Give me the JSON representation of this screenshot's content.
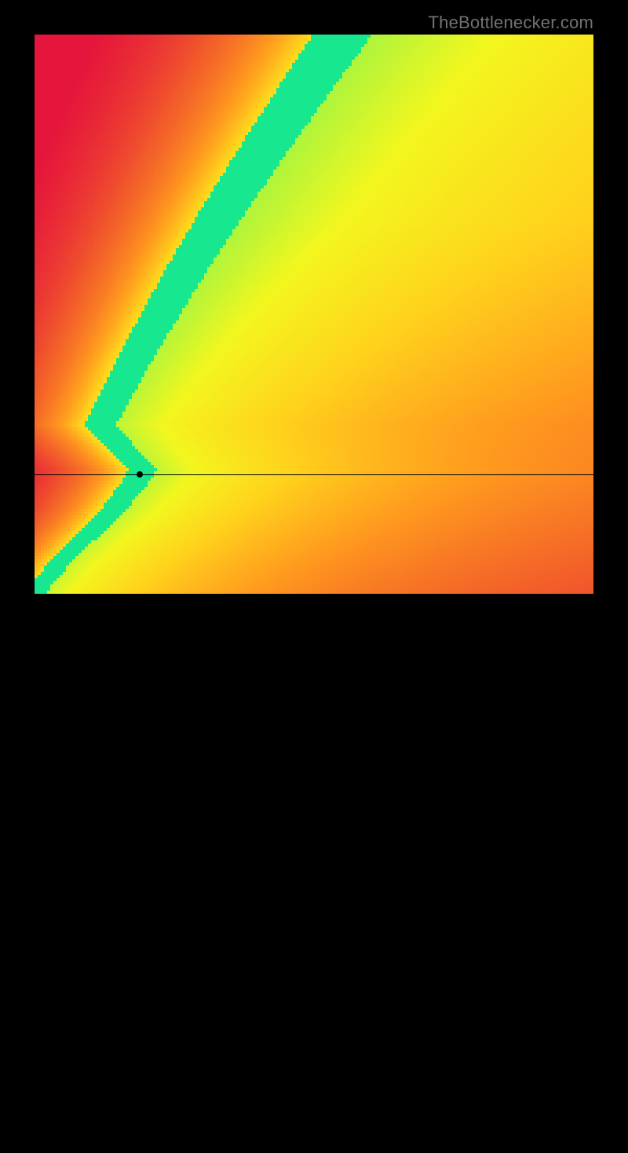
{
  "watermark": "TheBottlenecker.com",
  "chart_data": {
    "type": "heatmap",
    "title": "",
    "xlabel": "",
    "ylabel": "",
    "xlim": [
      0,
      1
    ],
    "ylim": [
      0,
      1
    ],
    "grid": false,
    "legend": false,
    "description": "Bottleneck-score heatmap. x and y are normalized component performance scores (0–1). Score 1 (green) = components are balanced; score 0 (red) = severe bottleneck. Ideal-balance ridge follows ideal_x(y) ≈ 0.55·y^1.3 for y>0.22, then bends toward origin.",
    "ideal_curve_samples": [
      {
        "y": 0.0,
        "x": 0.0
      },
      {
        "y": 0.05,
        "x": 0.04
      },
      {
        "y": 0.1,
        "x": 0.09
      },
      {
        "y": 0.15,
        "x": 0.14
      },
      {
        "y": 0.2,
        "x": 0.18
      },
      {
        "y": 0.22,
        "x": 0.19
      },
      {
        "y": 0.3,
        "x": 0.115
      },
      {
        "y": 0.4,
        "x": 0.167
      },
      {
        "y": 0.5,
        "x": 0.224
      },
      {
        "y": 0.6,
        "x": 0.283
      },
      {
        "y": 0.7,
        "x": 0.346
      },
      {
        "y": 0.8,
        "x": 0.412
      },
      {
        "y": 0.9,
        "x": 0.48
      },
      {
        "y": 1.0,
        "x": 0.55
      }
    ],
    "crosshair": {
      "x": 0.188,
      "y": 0.214
    },
    "color_scale": {
      "0.00": "#e5153b",
      "0.25": "#f25d2a",
      "0.50": "#ff9a1e",
      "0.70": "#ffd21c",
      "0.85": "#f3f61e",
      "0.95": "#a8f53e",
      "1.00": "#17e890"
    }
  }
}
